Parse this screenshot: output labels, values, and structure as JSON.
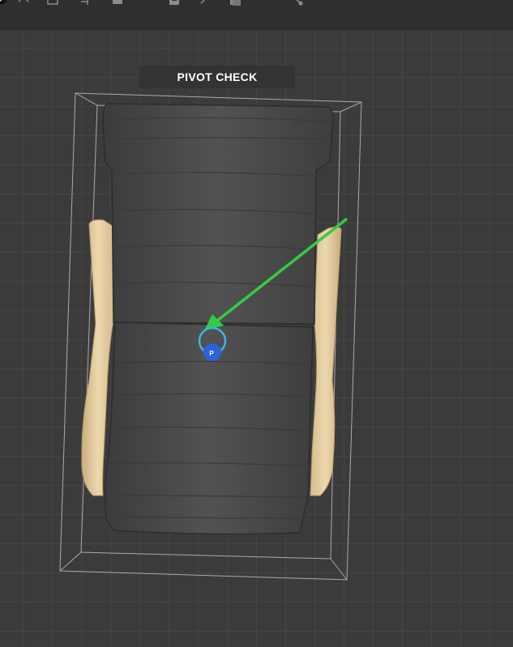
{
  "viewport": {
    "label": "PIVOT CHECK",
    "pivot_marker_text": "P"
  },
  "toolbar": {
    "icons": [
      "record-icon",
      "move-icon",
      "bounds-icon",
      "snap-icon",
      "save-icon",
      "arrow-icon",
      "layers-icon",
      "share-icon"
    ]
  },
  "colors": {
    "toolbar_bg": "#2f2f2f",
    "viewport_bg": "#3b3b3b",
    "grid_line": "#454545",
    "bounding_box": "#cfcfcf",
    "arrow": "#33cc44",
    "pivot_ring": "#39b6e6",
    "pivot_dot": "#2f62d8",
    "wood": "#e6cfa4",
    "cushion": "#4a4a4a"
  }
}
